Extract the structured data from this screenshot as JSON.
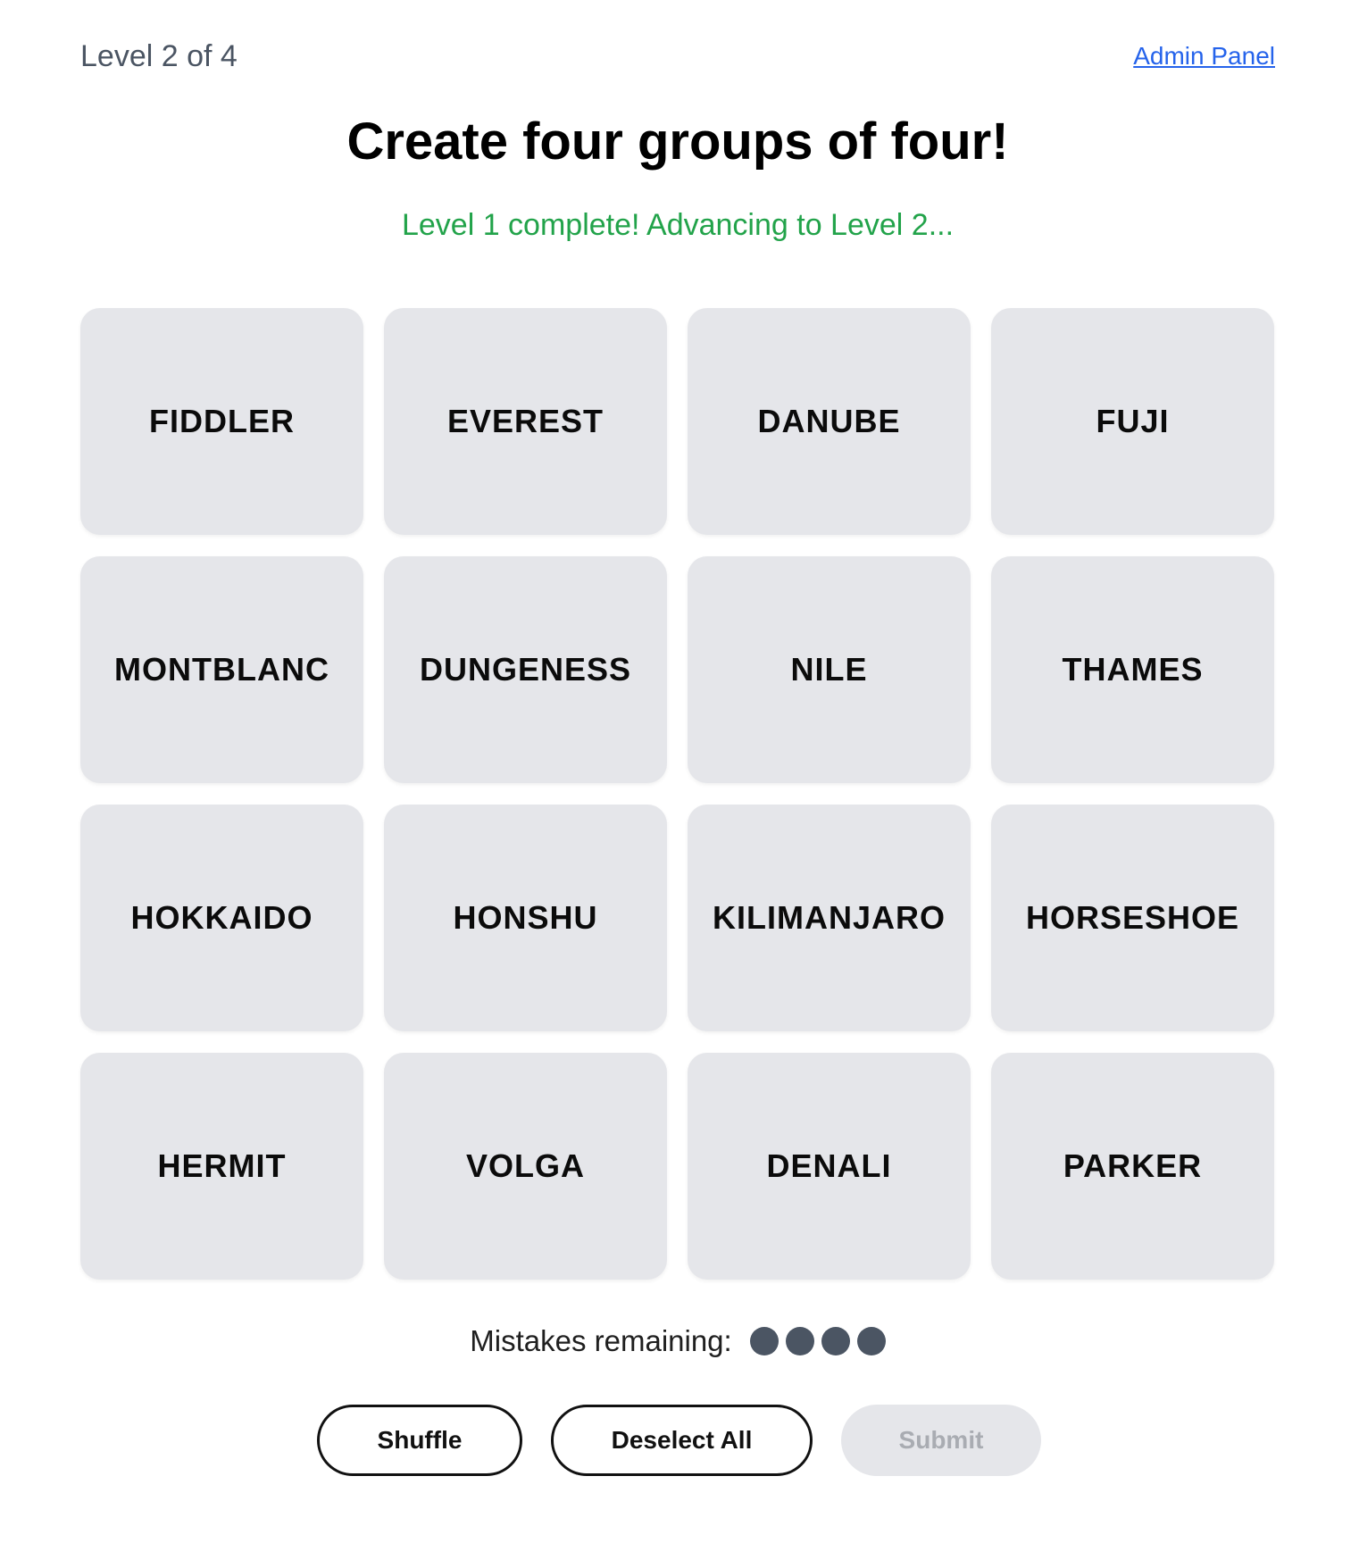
{
  "header": {
    "level_indicator": "Level 2 of 4",
    "admin_link": "Admin Panel"
  },
  "title": "Create four groups of four!",
  "status_message": "Level 1 complete! Advancing to Level 2...",
  "tiles": [
    "FIDDLER",
    "EVEREST",
    "DANUBE",
    "FUJI",
    "MONTBLANC",
    "DUNGENESS",
    "NILE",
    "THAMES",
    "HOKKAIDO",
    "HONSHU",
    "KILIMANJARO",
    "HORSESHOE",
    "HERMIT",
    "VOLGA",
    "DENALI",
    "PARKER"
  ],
  "mistakes": {
    "label": "Mistakes remaining:",
    "remaining": 4
  },
  "actions": {
    "shuffle": "Shuffle",
    "deselect_all": "Deselect All",
    "submit": "Submit"
  },
  "colors": {
    "tile_bg": "#e5e6ea",
    "status_green": "#22a34a",
    "link_blue": "#2563eb",
    "dot": "#4b5563",
    "submit_disabled_text": "#a9acb2"
  }
}
